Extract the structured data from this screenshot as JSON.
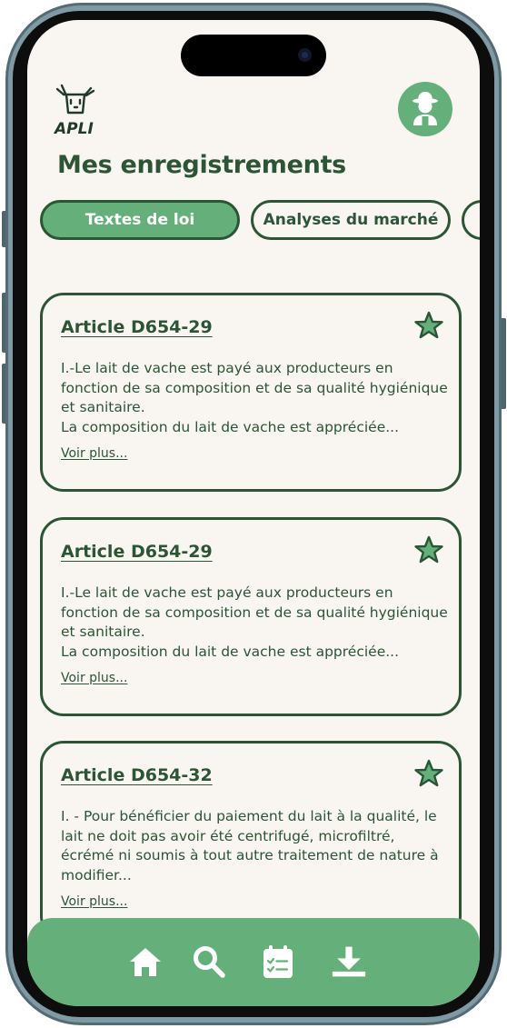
{
  "app": {
    "logo_text": "APLI"
  },
  "header": {
    "title": "Mes enregistrements"
  },
  "tabs": [
    {
      "label": "Textes de loi",
      "active": true
    },
    {
      "label": "Analyses du marché",
      "active": false
    },
    {
      "label": "",
      "active": false
    }
  ],
  "cards": [
    {
      "title": "Article D654-29",
      "paragraph1": "I.-Le lait de vache est payé aux producteurs en fonction de sa composition et de sa qualité hygiénique et sanitaire.",
      "paragraph2": "La composition du lait de vache est appréciée...",
      "more_label": "Voir plus..."
    },
    {
      "title": "Article D654-29",
      "paragraph1": "I.-Le lait de vache est payé aux producteurs en fonction de sa composition et de sa qualité hygiénique et sanitaire.",
      "paragraph2": "La composition du lait de vache est appréciée...",
      "more_label": "Voir plus..."
    },
    {
      "title": "Article D654-32",
      "paragraph1": "I. - Pour bénéficier du paiement du lait à la qualité, le lait ne doit pas avoir été centrifugé, microfiltré, écrémé ni soumis à tout autre traitement de nature à modifier...",
      "paragraph2": "",
      "more_label": "Voir plus..."
    }
  ],
  "navbar": {
    "items": [
      "home-icon",
      "search-icon",
      "calendar-checklist-icon",
      "download-icon"
    ]
  },
  "colors": {
    "primary_green": "#65b07a",
    "dark_green": "#2b5535",
    "background": "#f9f6f1"
  }
}
